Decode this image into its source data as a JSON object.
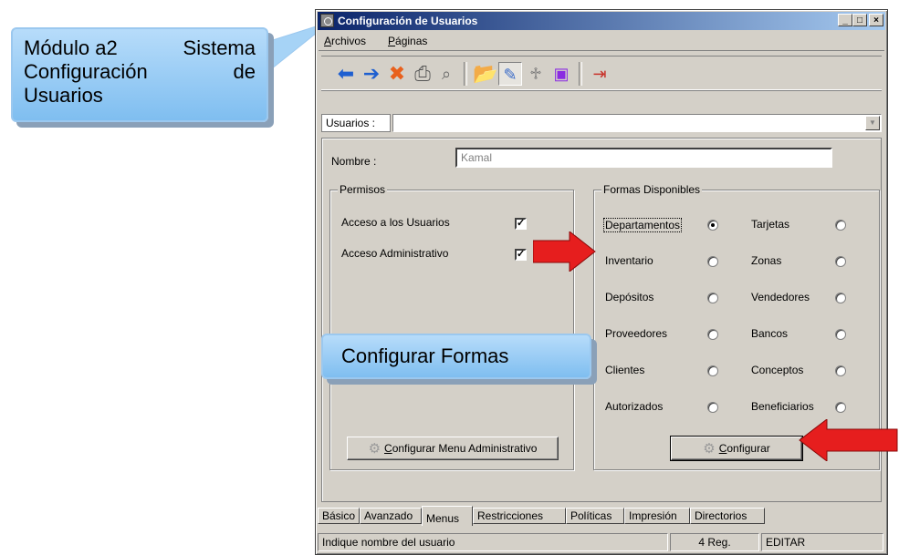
{
  "window": {
    "title": "Configuración de Usuarios",
    "controls": {
      "minimize": "_",
      "maximize": "□",
      "close": "×"
    }
  },
  "menu": [
    {
      "label": "Archivos"
    },
    {
      "label": "Páginas"
    }
  ],
  "toolbar": {
    "icons": [
      "arrow-left-icon",
      "arrow-right-icon",
      "delete-x-icon",
      "print-icon",
      "search-icon",
      "open-folder-icon",
      "edit-icon",
      "trash-icon",
      "save-icon",
      "exit-icon"
    ]
  },
  "usuarios": {
    "label": "Usuarios :",
    "value": ""
  },
  "nombre": {
    "label": "Nombre :",
    "value": "Kamal"
  },
  "permisos": {
    "title": "Permisos",
    "items": [
      {
        "label": "Acceso  a los Usuarios",
        "checked": true
      },
      {
        "label": "Acceso  Administrativo",
        "checked": true
      }
    ],
    "button": "Configurar Menu Administrativo"
  },
  "formas": {
    "title": "Formas Disponibles",
    "left": [
      "Departamentos",
      "Inventario",
      "Depósitos",
      "Proveedores",
      "Clientes",
      "Autorizados"
    ],
    "right": [
      "Tarjetas",
      "Zonas",
      "Vendedores",
      "Bancos",
      "Conceptos",
      "Beneficiarios"
    ],
    "selected": "Departamentos",
    "button": "Configurar"
  },
  "tabs": [
    "Básico",
    "Avanzado",
    "Menus",
    "Restricciones",
    "Políticas",
    "Impresión",
    "Directorios"
  ],
  "active_tab": "Menus",
  "status": {
    "message": "Indique nombre del usuario",
    "count": "4 Reg.",
    "mode": "EDITAR"
  },
  "callouts": {
    "top": {
      "line1_a": "Módulo a2",
      "line1_b": "Sistema",
      "line2_a": "Configuración",
      "line2_b": "de",
      "line3": "Usuarios"
    },
    "middle": "Configurar Formas"
  },
  "colors": {
    "arrow": "#e61e1e",
    "titlebar": "#0a246a",
    "callout": "#9ccff5"
  }
}
